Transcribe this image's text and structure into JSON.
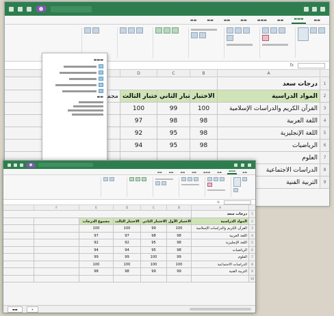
{
  "colors": {
    "titlebar": "#2e7d4f",
    "header_fill": "#cfe4b6",
    "badge": "#7e5aa8"
  },
  "back_window": {
    "sheet_title": "درجات سعد",
    "headers": [
      "المواد الدراسية",
      "الاختبار",
      "الاختبار الثاني",
      "الاختبار الثالث",
      "مجموع الدرجات"
    ],
    "rows": [
      {
        "subject": "القرآن الكريم والدراسات الإسلامية",
        "t1": "100",
        "t2": "99",
        "t3": "100"
      },
      {
        "subject": "اللغة العربية",
        "t1": "98",
        "t2": "98",
        "t3": "97"
      },
      {
        "subject": "اللغة الإنجليزية",
        "t1": "98",
        "t2": "95",
        "t3": "92"
      },
      {
        "subject": "الرياضيات",
        "t1": "98",
        "t2": "95",
        "t3": "94"
      },
      {
        "subject": "العلوم",
        "t1": "",
        "t2": "",
        "t3": ""
      },
      {
        "subject": "الدراسات الاجتماعية",
        "t1": "",
        "t2": "",
        "t3": ""
      },
      {
        "subject": "التربية الفنية",
        "t1": "",
        "t2": "",
        "t3": ""
      }
    ],
    "column_letters": [
      "A",
      "B",
      "C",
      "D",
      "E"
    ]
  },
  "front_window": {
    "sheet_title": "درجات سعد",
    "headers": [
      "المواد الدراسية",
      "الاختبار الأول",
      "الاختبار الثاني",
      "الاختبار الثالث",
      "مجموع الدرجات"
    ],
    "rows": [
      {
        "subject": "القرآن الكريم والدراسات الإسلامية",
        "t1": "100",
        "t2": "99",
        "t3": "100",
        "total": "100"
      },
      {
        "subject": "اللغة العربية",
        "t1": "98",
        "t2": "98",
        "t3": "97",
        "total": "97"
      },
      {
        "subject": "اللغة الإنجليزية",
        "t1": "98",
        "t2": "95",
        "t3": "92",
        "total": "92"
      },
      {
        "subject": "الرياضيات",
        "t1": "98",
        "t2": "95",
        "t3": "94",
        "total": "94"
      },
      {
        "subject": "العلوم",
        "t1": "99",
        "t2": "100",
        "t3": "99",
        "total": "99"
      },
      {
        "subject": "الدراسات الاجتماعية",
        "t1": "100",
        "t2": "100",
        "t3": "100",
        "total": "100"
      },
      {
        "subject": "التربية الفنية",
        "t1": "99",
        "t2": "99",
        "t3": "98",
        "total": "98"
      }
    ],
    "column_letters": [
      "A",
      "B",
      "C",
      "D",
      "E",
      "F"
    ]
  }
}
